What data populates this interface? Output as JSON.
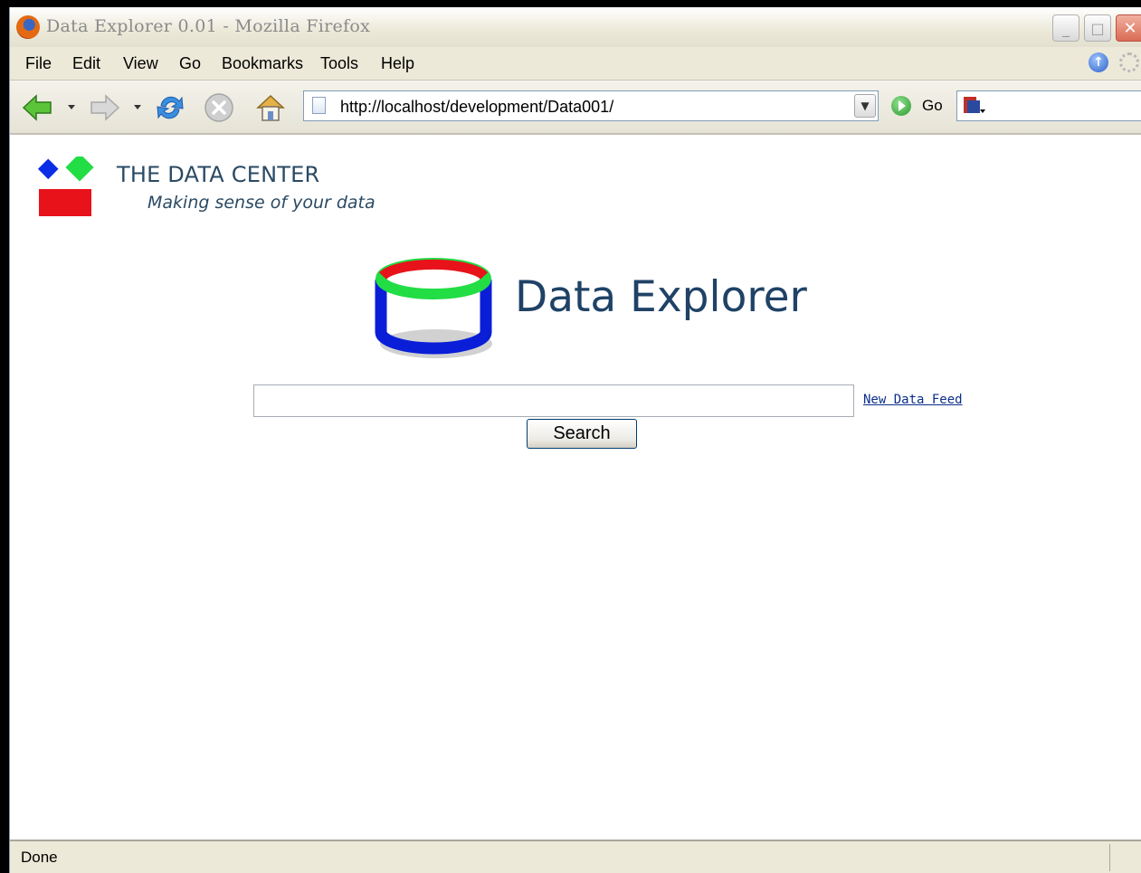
{
  "window": {
    "title": "Data Explorer 0.01 - Mozilla Firefox",
    "controls": {
      "minimize": "_",
      "maximize": "□",
      "close": "✕"
    }
  },
  "menu": {
    "items": [
      {
        "label": "File"
      },
      {
        "label": "Edit"
      },
      {
        "label": "View"
      },
      {
        "label": "Go"
      },
      {
        "label": "Bookmarks"
      },
      {
        "label": "Tools"
      },
      {
        "label": "Help"
      }
    ]
  },
  "toolbar": {
    "back_icon": "back-arrow-icon",
    "forward_icon": "forward-arrow-icon",
    "reload_icon": "reload-icon",
    "stop_icon": "stop-icon",
    "home_icon": "home-icon",
    "url": "http://localhost/development/Data001/",
    "go_label": "Go"
  },
  "page": {
    "brand_title": "THE DATA CENTER",
    "brand_subtitle": "Making sense of your data",
    "app_title": "Data Explorer",
    "search_value": "",
    "new_feed_link": "New Data Feed",
    "search_button": "Search",
    "colors": {
      "blue": "#0a2ee6",
      "green": "#22dd44",
      "red": "#e8121a",
      "title": "#1f4266"
    }
  },
  "status": {
    "text": "Done"
  }
}
